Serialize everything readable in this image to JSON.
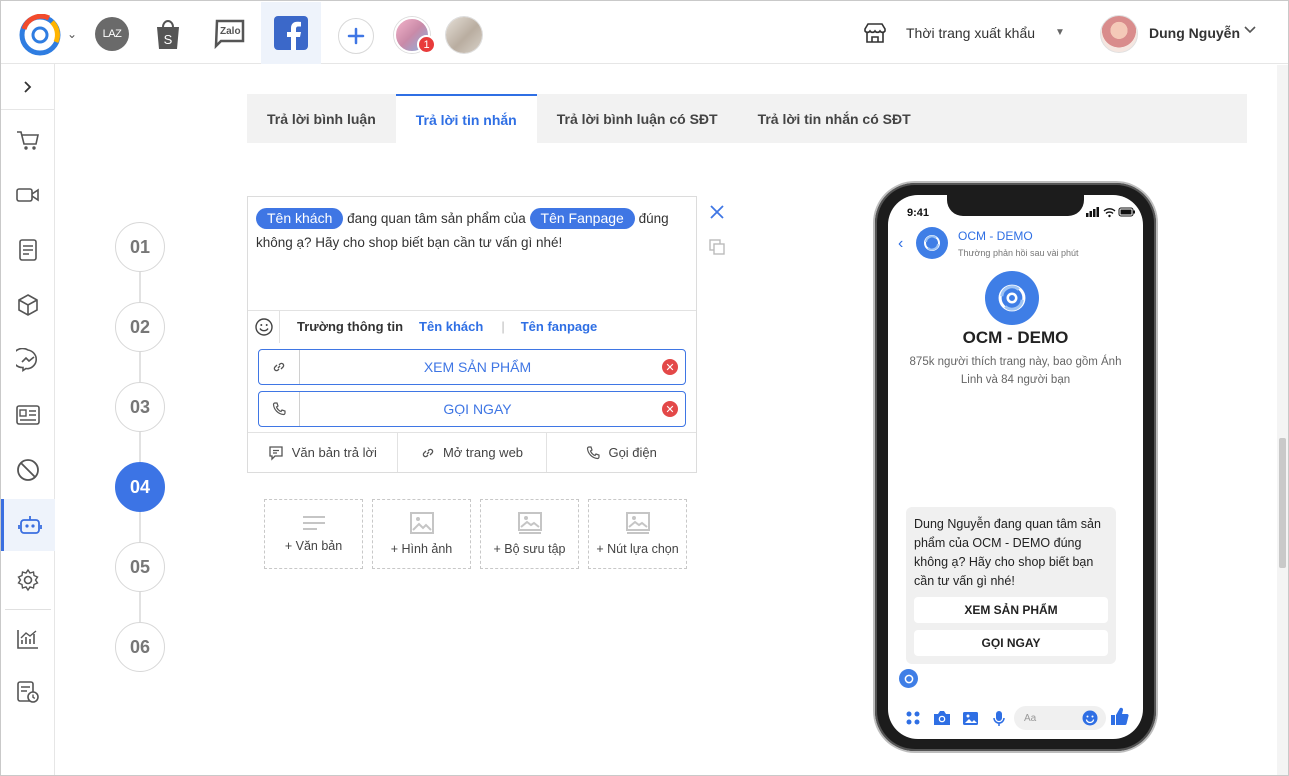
{
  "topbar": {
    "channels": {
      "lazada": "LAZ",
      "zalo": "Zalo"
    },
    "notification_count": "1",
    "store_name": "Thời trang xuất khẩu",
    "user_name": "Dung Nguyễn"
  },
  "tabs": [
    {
      "label": "Trả lời bình luận"
    },
    {
      "label": "Trả lời tin nhắn"
    },
    {
      "label": "Trả lời bình luận có SĐT"
    },
    {
      "label": "Trả lời tin nhắn có SĐT"
    }
  ],
  "active_tab": "Trả lời tin nhắn",
  "steps": [
    "01",
    "02",
    "03",
    "04",
    "05",
    "06"
  ],
  "active_step": "04",
  "editor": {
    "chip_customer": "Tên khách",
    "text_part1": "đang quan tâm sản phẩm của",
    "chip_fanpage": "Tên Fanpage",
    "text_part2": "đúng không ạ? Hãy cho shop biết bạn cần tư vấn gì nhé!",
    "field_label": "Trường thông tin",
    "field_customer": "Tên khách",
    "field_separator": "|",
    "field_fanpage": "Tên fanpage",
    "buttons": [
      {
        "label": "XEM SẢN PHẨM",
        "icon": "link-icon"
      },
      {
        "label": "GỌI NGAY",
        "icon": "phone-icon"
      }
    ],
    "actions": [
      {
        "label": "Văn bản trả lời",
        "icon": "message-icon"
      },
      {
        "label": "Mở trang web",
        "icon": "link-icon"
      },
      {
        "label": "Gọi điện",
        "icon": "phone-icon"
      }
    ]
  },
  "add_cards": [
    {
      "label": "+ Văn bản",
      "icon": "text-icon"
    },
    {
      "label": "+ Hình ảnh",
      "icon": "image-icon"
    },
    {
      "label": "+ Bộ sưu tập",
      "icon": "gallery-icon"
    },
    {
      "label": "+ Nút lựa chọn",
      "icon": "buttons-icon"
    }
  ],
  "preview": {
    "time": "9:41",
    "page_name": "OCM - DEMO",
    "reply_time": "Thường phản hồi sau vài phút",
    "page_title": "OCM - DEMO",
    "page_desc": "875k người thích trang này, bao gồm Ánh Linh và 84 người bạn",
    "message": "Dung Nguyễn đang quan tâm sản phẩm của OCM - DEMO đúng không ạ? Hãy cho shop biết bạn cần tư vấn gì nhé!",
    "quick_buttons": [
      "XEM SẢN PHẨM",
      "GỌI NGAY"
    ],
    "input_placeholder": "Aa"
  },
  "colors": {
    "accent": "#3f76e4",
    "danger": "#e34848",
    "tab_bg": "#f2f2f2"
  }
}
